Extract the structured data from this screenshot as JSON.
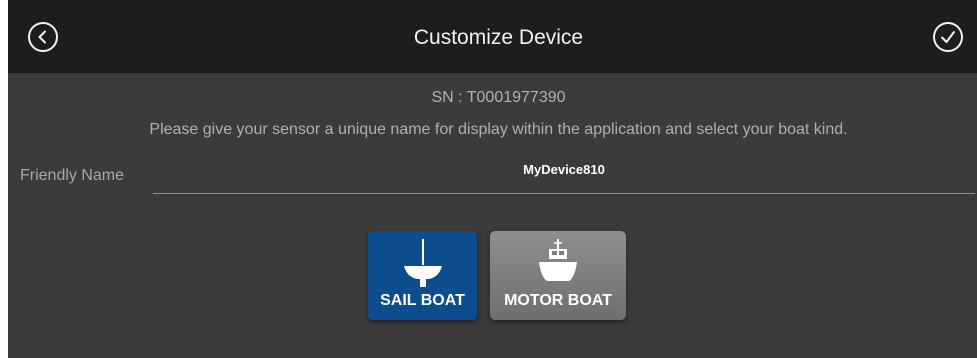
{
  "header": {
    "title": "Customize Device",
    "back_icon": "chevron-left-circle-icon",
    "confirm_icon": "checkmark-circle-icon"
  },
  "device": {
    "serial_text": "SN : T0001977390",
    "instructions": "Please give your sensor a unique name for display within the application and select your boat kind."
  },
  "form": {
    "friendly_name_label": "Friendly Name",
    "friendly_name_value": "MyDevice810"
  },
  "boat_kinds": {
    "sail": {
      "label": "SAIL BOAT",
      "icon": "sailboat-icon",
      "selected": true
    },
    "motor": {
      "label": "MOTOR BOAT",
      "icon": "motorboat-icon",
      "selected": false
    }
  },
  "colors": {
    "header_bg": "#1d1d1d",
    "body_bg": "#3b3b3b",
    "selected_bg": "#0d4d8e",
    "unselected_bg": "#7c7c7c"
  }
}
